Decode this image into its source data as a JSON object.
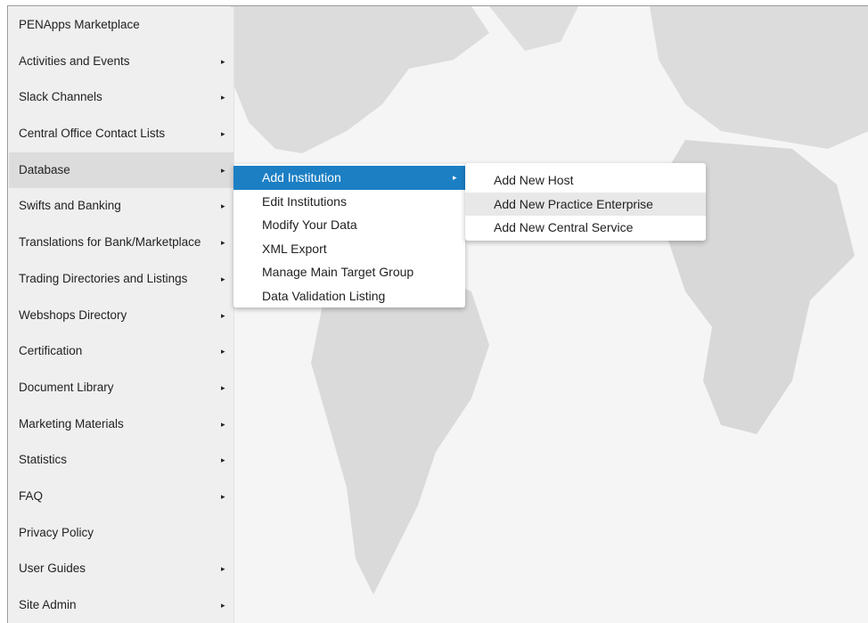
{
  "sidebar": {
    "items": [
      {
        "label": "PENApps Marketplace",
        "has_submenu": false,
        "active": false
      },
      {
        "label": "Activities and Events",
        "has_submenu": true,
        "active": false
      },
      {
        "label": "Slack Channels",
        "has_submenu": true,
        "active": false
      },
      {
        "label": "Central Office Contact Lists",
        "has_submenu": true,
        "active": false
      },
      {
        "label": "Database",
        "has_submenu": true,
        "active": true
      },
      {
        "label": "Swifts and Banking",
        "has_submenu": true,
        "active": false
      },
      {
        "label": "Translations for Bank/Marketplace",
        "has_submenu": true,
        "active": false
      },
      {
        "label": "Trading Directories and Listings",
        "has_submenu": true,
        "active": false
      },
      {
        "label": "Webshops Directory",
        "has_submenu": true,
        "active": false
      },
      {
        "label": "Certification",
        "has_submenu": true,
        "active": false
      },
      {
        "label": "Document Library",
        "has_submenu": true,
        "active": false
      },
      {
        "label": "Marketing Materials",
        "has_submenu": true,
        "active": false
      },
      {
        "label": "Statistics",
        "has_submenu": true,
        "active": false
      },
      {
        "label": "FAQ",
        "has_submenu": true,
        "active": false
      },
      {
        "label": "Privacy Policy",
        "has_submenu": false,
        "active": false
      },
      {
        "label": "User Guides",
        "has_submenu": true,
        "active": false
      },
      {
        "label": "Site Admin",
        "has_submenu": true,
        "active": false
      }
    ],
    "arrow_glyph": "▸"
  },
  "database_menu": {
    "items": [
      {
        "label": "Add Institution",
        "active": true,
        "has_submenu": true
      },
      {
        "label": "Edit Institutions"
      },
      {
        "label": "Modify Your Data"
      },
      {
        "label": "XML Export"
      },
      {
        "label": "Manage Main Target Group"
      },
      {
        "label": "Data Validation Listing"
      }
    ]
  },
  "institution_menu": {
    "items": [
      {
        "label": "Add New Host"
      },
      {
        "label": "Add New Practice Enterprise",
        "hover": true
      },
      {
        "label": "Add New Central Service"
      }
    ]
  },
  "colors": {
    "accent": "#1c7fc4",
    "sidebar_bg": "#efefef",
    "sidebar_active": "#dcdcdc",
    "map_land": "#dedede"
  }
}
